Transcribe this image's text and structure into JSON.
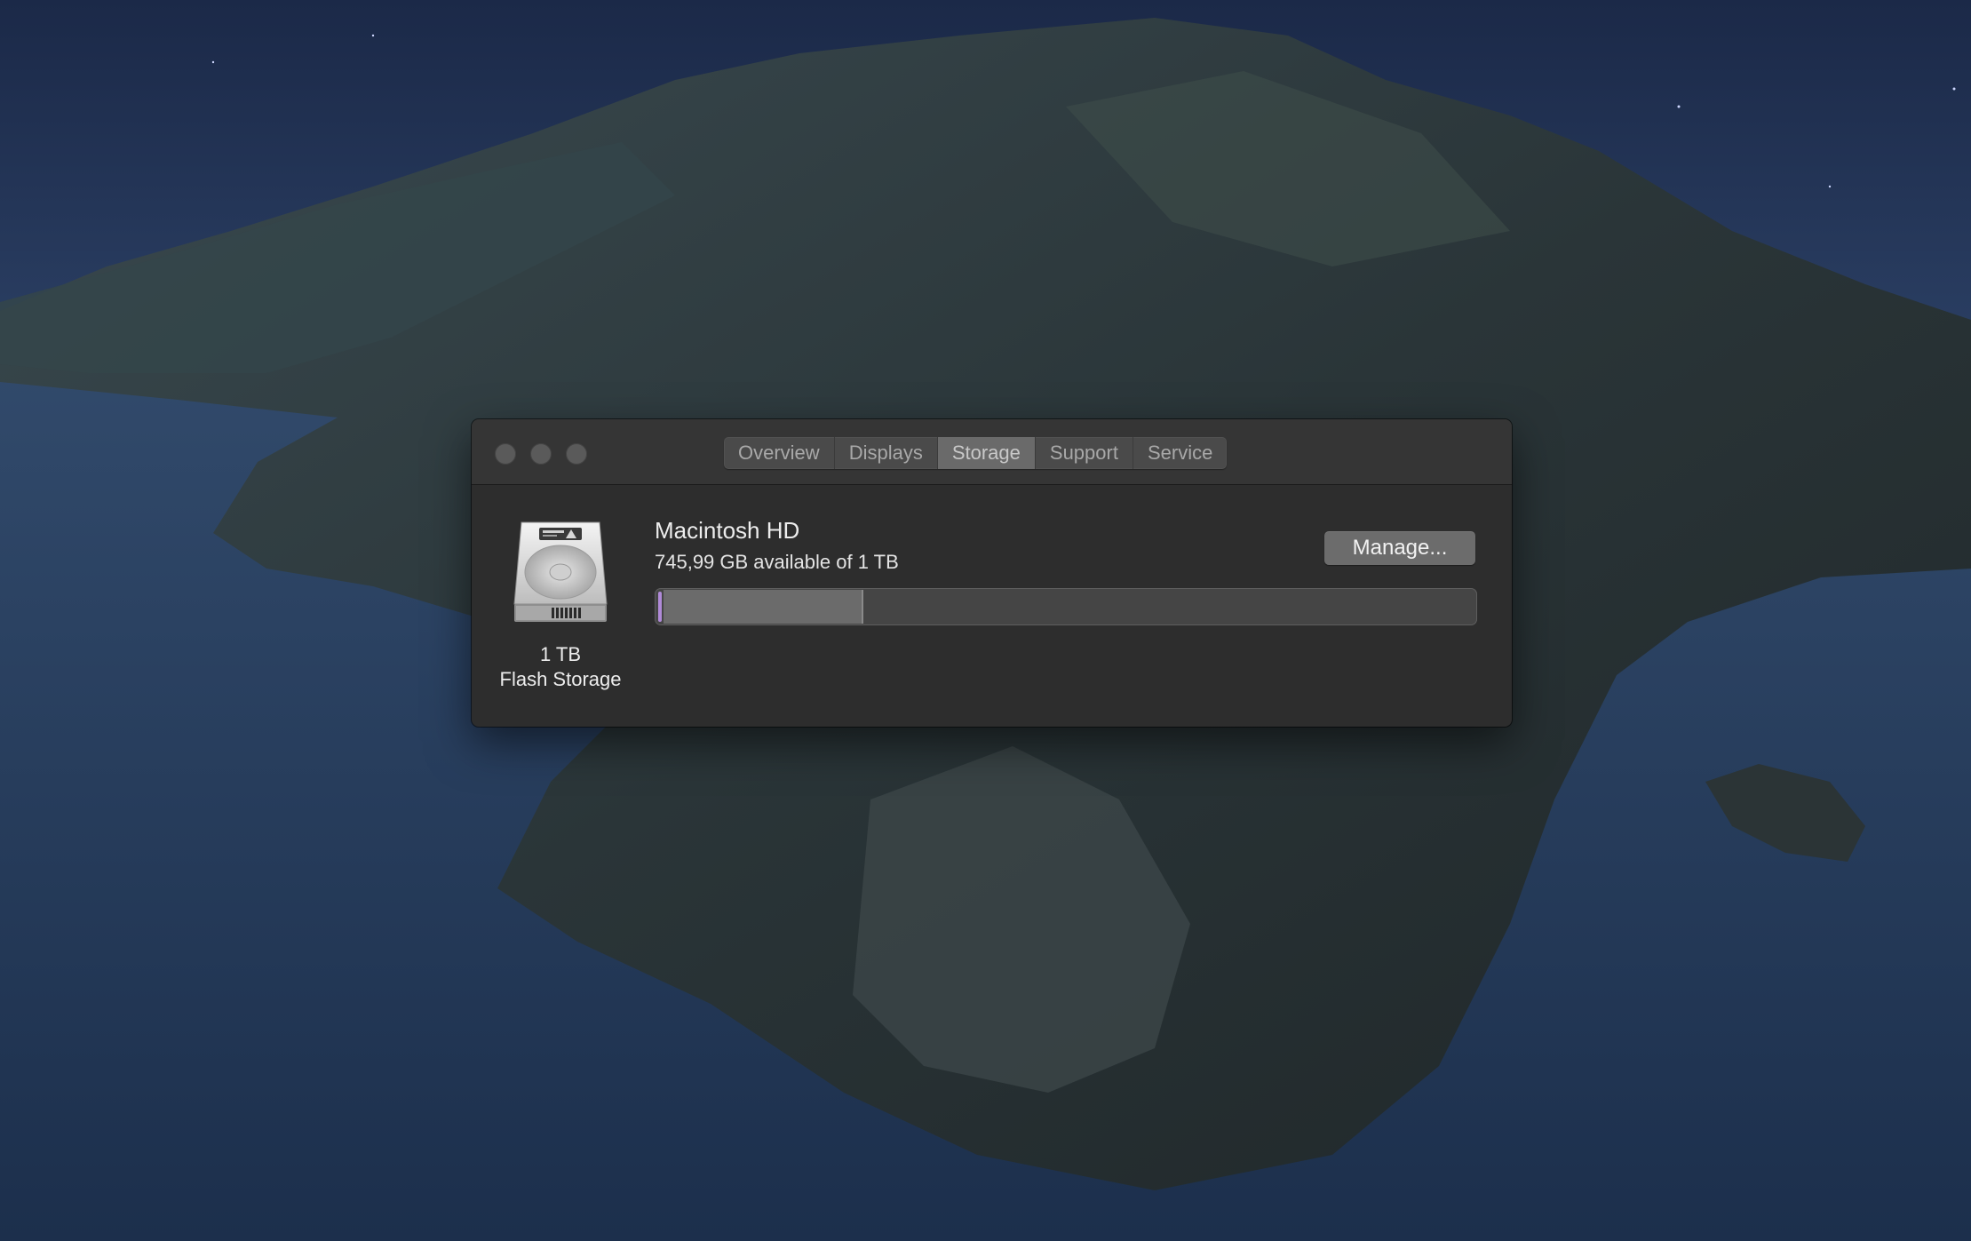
{
  "window": {
    "tabs": [
      {
        "label": "Overview",
        "active": false
      },
      {
        "label": "Displays",
        "active": false
      },
      {
        "label": "Storage",
        "active": true
      },
      {
        "label": "Support",
        "active": false
      },
      {
        "label": "Service",
        "active": false
      }
    ]
  },
  "storage": {
    "disk_icon": "hard-drive-icon",
    "disk_capacity": "1 TB",
    "disk_type": "Flash Storage",
    "volume_name": "Macintosh HD",
    "available_text": "745,99 GB available of 1 TB",
    "manage_label": "Manage...",
    "used_fraction": 0.254,
    "system_color": "#b08ad8",
    "used_color": "#6b6b6b"
  },
  "colors": {
    "window_bg": "#2d2d2d",
    "titlebar_bg": "#353535",
    "active_tab_bg": "#6a6a6a"
  }
}
